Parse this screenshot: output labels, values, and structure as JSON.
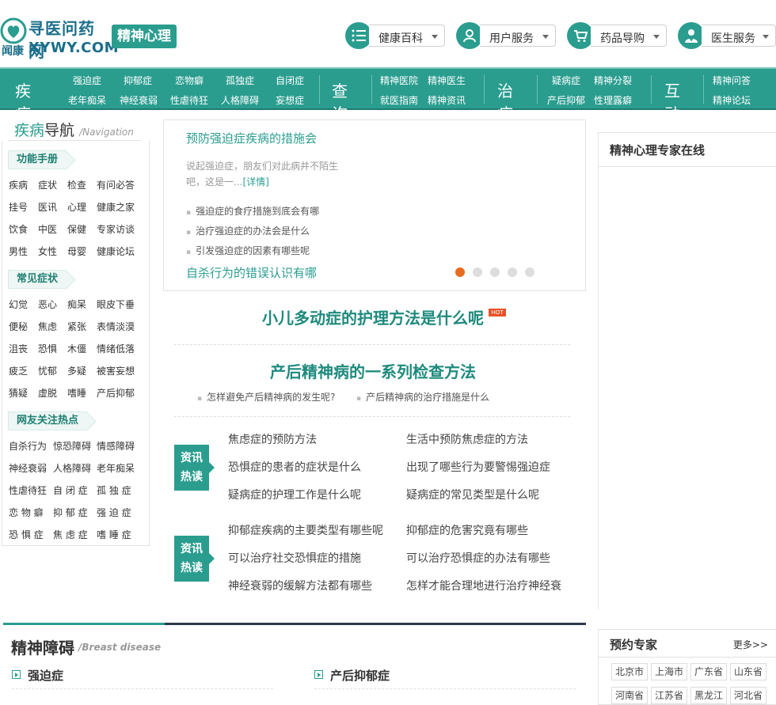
{
  "header": {
    "logo_cn": "寻医问药网",
    "logo_sub": "闻康",
    "logo_en": "XYWY.COM",
    "channel": "精神心理",
    "topnav": [
      {
        "label": "健康百科",
        "icon": "list-icon"
      },
      {
        "label": "用户服务",
        "icon": "user-icon"
      },
      {
        "label": "药品导购",
        "icon": "cart-icon"
      },
      {
        "label": "医生服务",
        "icon": "doctor-icon"
      }
    ]
  },
  "mainnav": {
    "groups": [
      {
        "title": "疾病",
        "links": [
          "强迫症",
          "抑郁症",
          "恋物癖",
          "孤独症",
          "自闭症",
          "老年痴呆",
          "神经衰弱",
          "性虐待狂",
          "人格障碍",
          "妄想症"
        ]
      },
      {
        "title": "查询",
        "links": [
          "精神医院",
          "精神医生",
          "就医指南",
          "精神资讯"
        ]
      },
      {
        "title": "治疗",
        "links": [
          "疑病症",
          "精神分裂",
          "产后抑郁",
          "性理露癖"
        ]
      },
      {
        "title": "互动",
        "links": [
          "精神问答",
          "精神论坛"
        ]
      }
    ]
  },
  "sidebar": {
    "title_a": "疾病",
    "title_b": "导航",
    "title_en": "Navigation",
    "sections": [
      {
        "tag": "功能手册",
        "items": [
          "疾病",
          "症状",
          "检查",
          "有问必答",
          "挂号",
          "医讯",
          "心理",
          "健康之家",
          "饮食",
          "中医",
          "保健",
          "专家访谈",
          "男性",
          "女性",
          "母婴",
          "健康论坛"
        ]
      },
      {
        "tag": "常见症状",
        "items": [
          "幻觉",
          "恶心",
          "痴呆",
          "眼皮下垂",
          "便秘",
          "焦虑",
          "紧张",
          "表情淡漠",
          "沮丧",
          "恐惧",
          "木僵",
          "情绪低落",
          "疲乏",
          "忧郁",
          "多疑",
          "被害妄想",
          "猜疑",
          "虚脱",
          "嗜睡",
          "产后抑郁"
        ]
      },
      {
        "tag": "网友关注热点",
        "rows": [
          [
            "自杀行为",
            "惊恐障碍",
            "情感障碍"
          ],
          [
            "神经衰弱",
            "人格障碍",
            "老年痴呆"
          ],
          [
            "性虐待狂",
            "自 闭 症",
            "孤 独 症"
          ],
          [
            "恋 物 癖",
            "抑 郁 症",
            "强 迫 症"
          ],
          [
            "恐 惧 症",
            "焦 虑 症",
            "嗜 睡 症"
          ]
        ]
      }
    ]
  },
  "slider": {
    "headline": "预防强迫症疾病的措施会",
    "desc": "说起强迫症，朋友们对此病并不陌生吧，这是一...",
    "detail": "[详情]",
    "links": [
      "强迫症的食疗措施到底会有哪",
      "治疗强迫症的办法会是什么",
      "引发强迫症的因素有哪些呢"
    ],
    "headline2": "自杀行为的错误认识有哪",
    "dots": 5,
    "active_dot": 0
  },
  "hot": {
    "title1": "小儿多动症的护理方法是什么呢",
    "badge": "HOT",
    "title2": "产后精神病的一系列检查方法",
    "links": [
      "怎样避免产后精神病的发生呢?",
      "产后精神病的治疗措施是什么"
    ]
  },
  "reading": {
    "badge_a": "资讯",
    "badge_b": "热读",
    "blocks": [
      [
        "焦虑症的预防方法",
        "生活中预防焦虑症的方法",
        "恐惧症的患者的症状是什么",
        "出现了哪些行为要警惕强迫症",
        "疑病症的护理工作是什么呢",
        "疑病症的常见类型是什么呢"
      ],
      [
        "抑郁症疾病的主要类型有哪些呢",
        "抑郁症的危害究竟有哪些",
        "可以治疗社交恐惧症的措施",
        "可以治疗恐惧症的办法有哪些",
        "神经衰弱的缓解方法都有哪些",
        "怎样才能合理地进行治疗神经衰"
      ]
    ]
  },
  "right": {
    "expert_title": "精神心理专家在线",
    "book_title": "预约专家",
    "book_more": "更多>>",
    "provinces": [
      "北京市",
      "上海市",
      "广东省",
      "山东省",
      "河南省",
      "江苏省",
      "黑龙江",
      "河北省"
    ]
  },
  "section": {
    "title": "精神障碍",
    "sub": "/Breast disease",
    "cols": [
      "强迫症",
      "产后抑郁症"
    ]
  },
  "colors": {
    "brand": "#2a9d8f",
    "hot": "#e86c1f"
  }
}
